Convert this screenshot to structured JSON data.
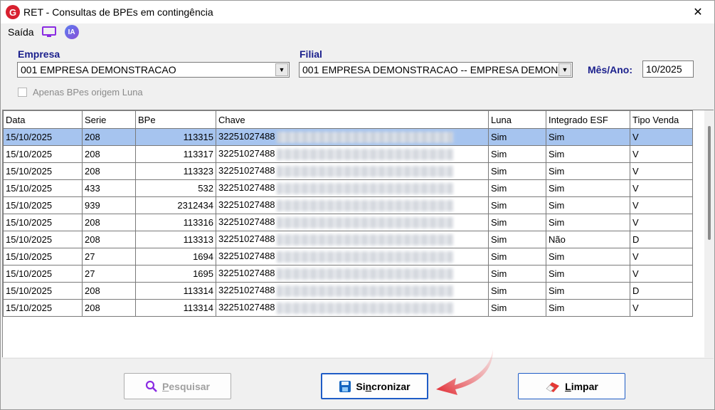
{
  "window": {
    "logo_letter": "G",
    "title": "RET - Consultas de BPEs em contingência",
    "close_glyph": "✕"
  },
  "menu": {
    "saida_label": "Saída",
    "ia_label": "IA"
  },
  "filters": {
    "empresa_label": "Empresa",
    "empresa_value": "001 EMPRESA DEMONSTRACAO",
    "filial_label": "Filial",
    "filial_value": "001 EMPRESA DEMONSTRACAO -- EMPRESA DEMONSTRACAO",
    "mes_ano_label": "Mês/Ano:",
    "mes_ano_value": "10/2025",
    "apenas_luna_label": "Apenas BPes origem Luna",
    "combo_arrow": "▼"
  },
  "grid": {
    "columns": [
      "Data",
      "Serie",
      "BPe",
      "Chave",
      "Luna",
      "Integrado ESF",
      "Tipo Venda"
    ],
    "rows": [
      {
        "data": "15/10/2025",
        "serie": "208",
        "bpe": "113315",
        "chave": "32251027488",
        "luna": "Sim",
        "esf": "Sim",
        "tipo": "V"
      },
      {
        "data": "15/10/2025",
        "serie": "208",
        "bpe": "113317",
        "chave": "32251027488",
        "luna": "Sim",
        "esf": "Sim",
        "tipo": "V"
      },
      {
        "data": "15/10/2025",
        "serie": "208",
        "bpe": "113323",
        "chave": "32251027488",
        "luna": "Sim",
        "esf": "Sim",
        "tipo": "V"
      },
      {
        "data": "15/10/2025",
        "serie": "433",
        "bpe": "532",
        "chave": "32251027488",
        "luna": "Sim",
        "esf": "Sim",
        "tipo": "V"
      },
      {
        "data": "15/10/2025",
        "serie": "939",
        "bpe": "2312434",
        "chave": "32251027488",
        "luna": "Sim",
        "esf": "Sim",
        "tipo": "V"
      },
      {
        "data": "15/10/2025",
        "serie": "208",
        "bpe": "113316",
        "chave": "32251027488",
        "luna": "Sim",
        "esf": "Sim",
        "tipo": "V"
      },
      {
        "data": "15/10/2025",
        "serie": "208",
        "bpe": "113313",
        "chave": "32251027488",
        "luna": "Sim",
        "esf": "Não",
        "tipo": "D"
      },
      {
        "data": "15/10/2025",
        "serie": "27",
        "bpe": "1694",
        "chave": "32251027488",
        "luna": "Sim",
        "esf": "Sim",
        "tipo": "V"
      },
      {
        "data": "15/10/2025",
        "serie": "27",
        "bpe": "1695",
        "chave": "32251027488",
        "luna": "Sim",
        "esf": "Sim",
        "tipo": "V"
      },
      {
        "data": "15/10/2025",
        "serie": "208",
        "bpe": "113314",
        "chave": "32251027488",
        "luna": "Sim",
        "esf": "Sim",
        "tipo": "D"
      },
      {
        "data": "15/10/2025",
        "serie": "208",
        "bpe": "113314",
        "chave": "32251027488",
        "luna": "Sim",
        "esf": "Sim",
        "tipo": "V"
      }
    ]
  },
  "buttons": {
    "pesquisar": {
      "first": "P",
      "rest": "esquisar"
    },
    "sincronizar": {
      "pre": "Si",
      "under": "n",
      "post": "cronizar"
    },
    "limpar": {
      "first": "L",
      "rest": "impar"
    }
  },
  "colors": {
    "label_blue": "#1a1f8c",
    "selected_row": "#a6c4ef",
    "annotation_arrow": "#e0232b",
    "logo_red": "#d8202f"
  }
}
